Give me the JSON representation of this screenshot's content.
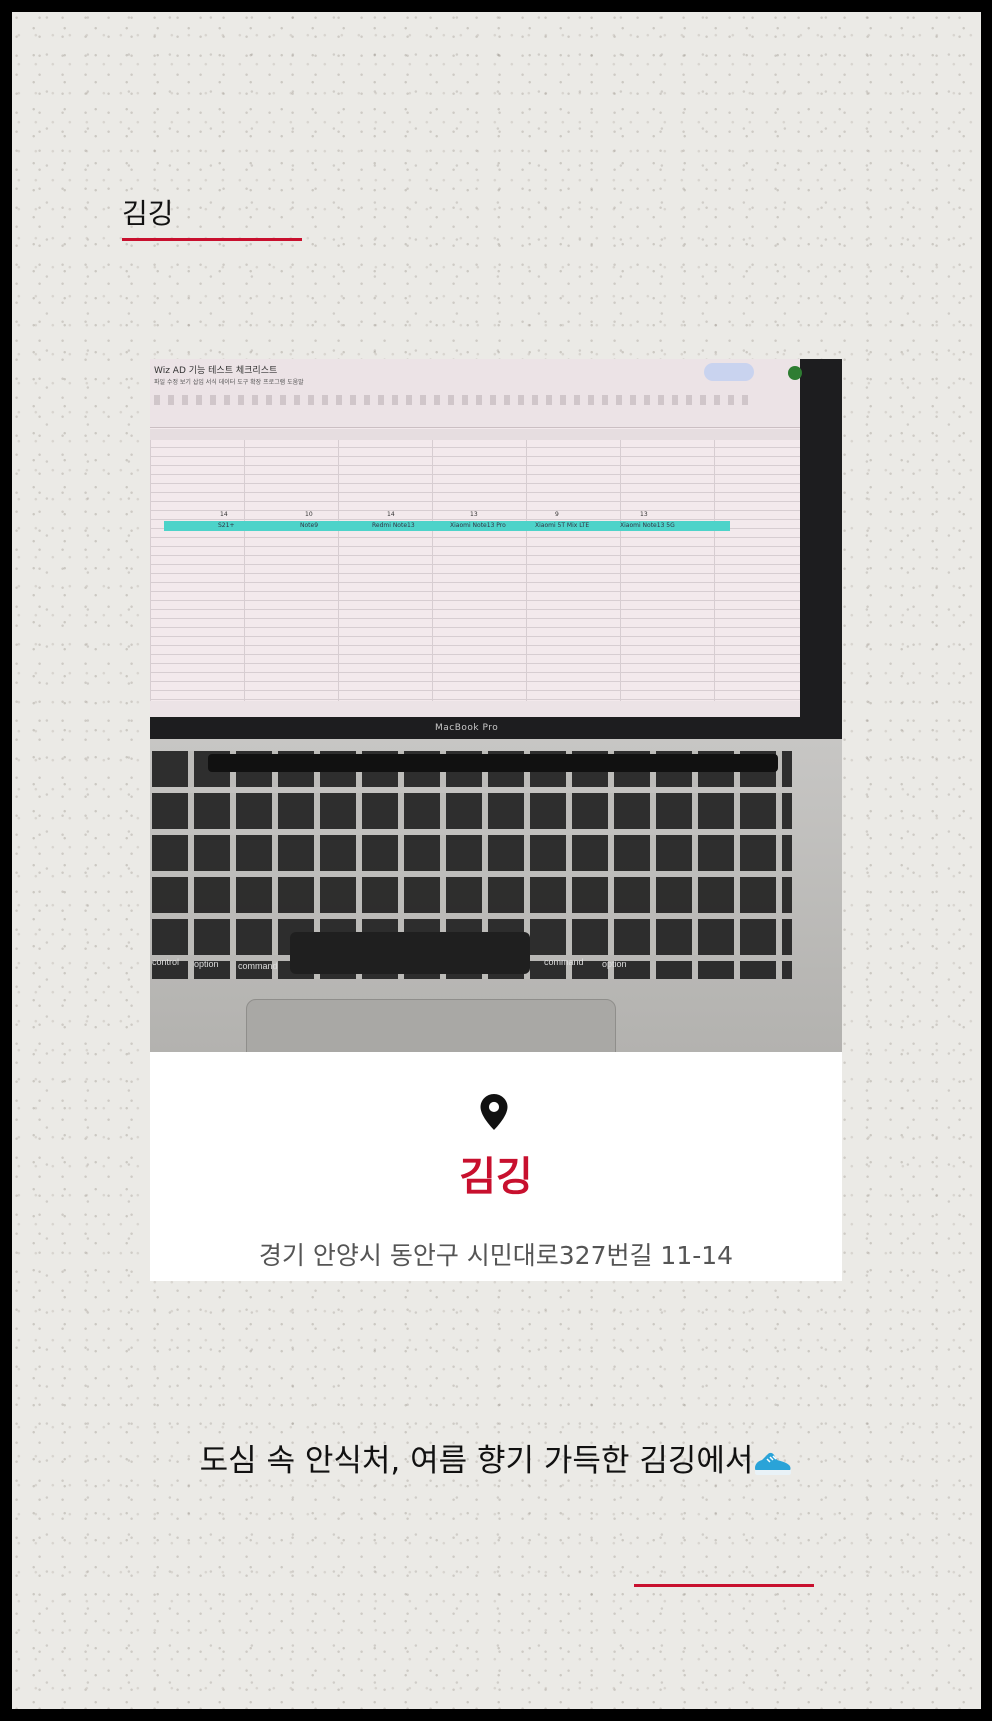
{
  "header": {
    "brand": "김깅"
  },
  "photo": {
    "sheet_title": "Wiz AD 기능 테스트 체크리스트",
    "sheet_menu": "파일  수정  보기  삽입  서식  데이터  도구  확장 프로그램  도움말",
    "sheet_numbers": [
      "14",
      "10",
      "14",
      "13",
      "9",
      "13"
    ],
    "sheet_columns": [
      "S21+",
      "Note9",
      "Redmi Note13",
      "Xiaomi Note13 Pro",
      "Xiaomi 5T Mix LTE",
      "Xiaomi Note13 5G"
    ],
    "laptop_label": "MacBook Pro",
    "keys": {
      "control": "control",
      "option": "option",
      "command": "command",
      "command_right": "command",
      "option_right": "option"
    }
  },
  "card": {
    "title": "김깅",
    "address": "경기 안양시 동안구 시민대로327번길 11-14"
  },
  "tagline": "도심 속 안식처, 여름 향기 가득한 김깅에서",
  "colors": {
    "accent": "#c8102e",
    "frame": "#000000",
    "paper": "#ebeae6"
  }
}
